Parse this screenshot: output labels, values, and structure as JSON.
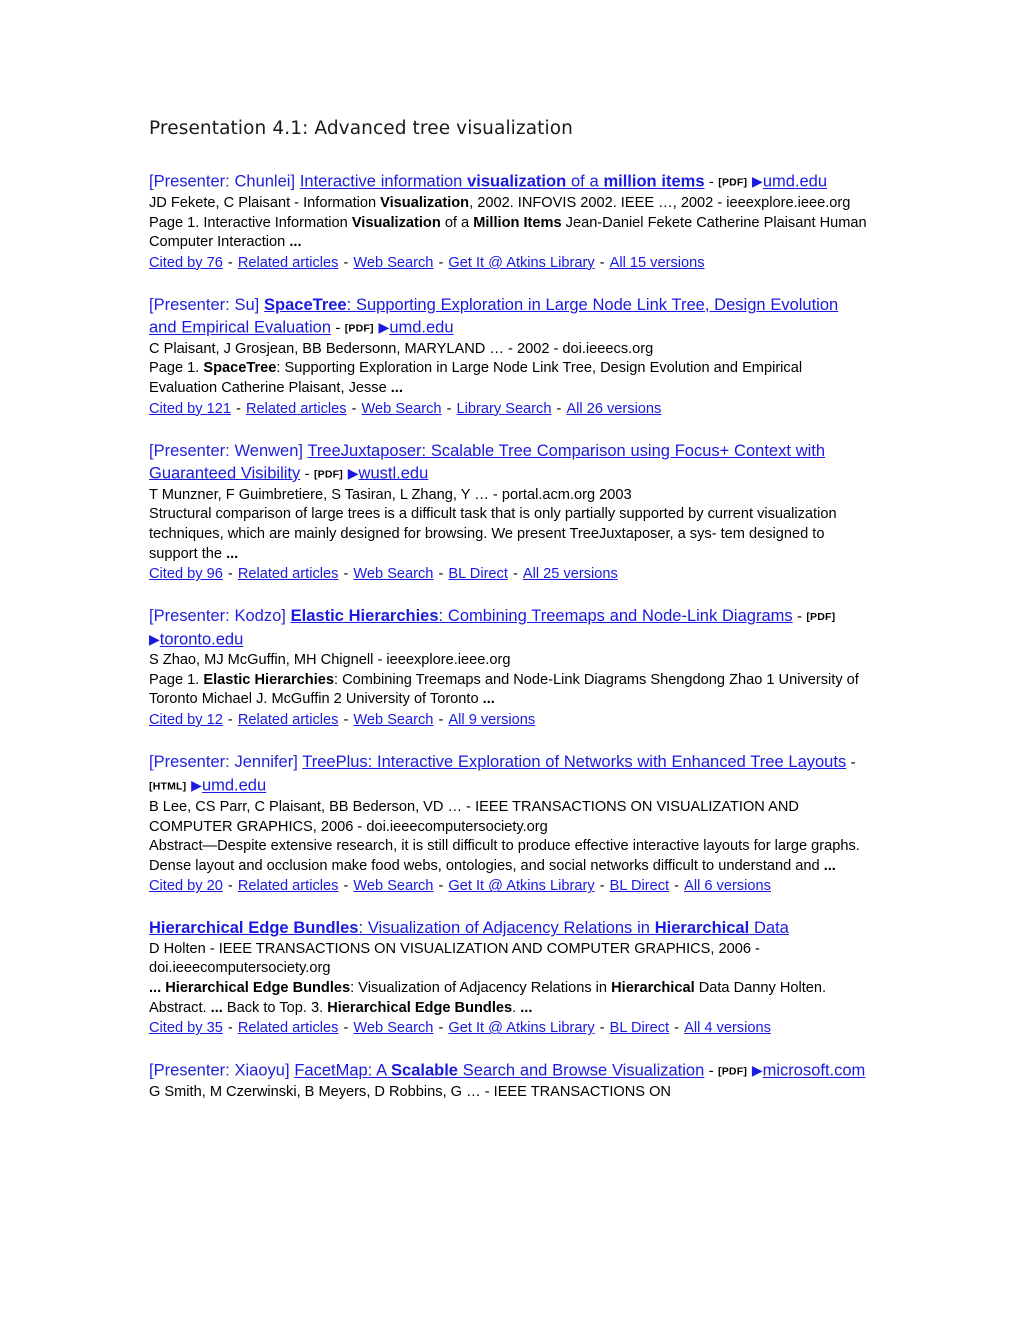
{
  "document": {
    "heading": "Presentation 4.1: Advanced tree visualization"
  },
  "colors": {
    "link": "#1a1ae0",
    "presenter": "#2222dd",
    "text": "#000000",
    "heading": "#1a1a1a",
    "background": "#ffffff"
  },
  "icons": {
    "play_triangle": "▶"
  },
  "separators": {
    "dash": "-",
    "footer_dash": "-"
  },
  "results": [
    {
      "presenter": "[Presenter: Chunlei]",
      "title_parts": [
        {
          "text": "Interactive information ",
          "bold": false
        },
        {
          "text": "visualization",
          "bold": true
        },
        {
          "text": " of a ",
          "bold": false
        },
        {
          "text": "million items",
          "bold": true
        }
      ],
      "file_tag": "[PDF]",
      "domain": "umd.edu",
      "meta": "JD Fekete, C Plaisant - Information Visualization, 2002. INFOVIS 2002. IEEE …, 2002 - ieeexplore.ieee.org",
      "meta_parts": [
        {
          "text": "JD Fekete, C Plaisant - Information ",
          "bold": false
        },
        {
          "text": "Visualization",
          "bold": true
        },
        {
          "text": ", 2002. INFOVIS 2002. IEEE …, 2002 - ieeexplore.ieee.org",
          "bold": false
        }
      ],
      "snippet_parts": [
        {
          "text": "Page 1. Interactive Information ",
          "bold": false
        },
        {
          "text": "Visualization",
          "bold": true
        },
        {
          "text": " of a ",
          "bold": false
        },
        {
          "text": "Million Items",
          "bold": true
        },
        {
          "text": " Jean-Daniel Fekete Catherine Plaisant Human Computer Interaction ",
          "bold": false
        },
        {
          "text": "...",
          "bold": true
        }
      ],
      "footer_links": [
        "Cited by 76",
        "Related articles",
        "Web Search",
        "Get It @ Atkins Library",
        "All 15 versions"
      ]
    },
    {
      "presenter": "[Presenter: Su]",
      "title_parts": [
        {
          "text": "SpaceTree",
          "bold": true
        },
        {
          "text": ": Supporting Exploration in Large Node Link Tree, Design Evolution and Empirical Evaluation",
          "bold": false
        }
      ],
      "file_tag": "[PDF]",
      "domain": "umd.edu",
      "meta_parts": [
        {
          "text": "C Plaisant, J Grosjean, BB Bedersonn, MARYLAND … - 2002 - doi.ieeecs.org",
          "bold": false
        }
      ],
      "snippet_parts": [
        {
          "text": "Page 1. ",
          "bold": false
        },
        {
          "text": "SpaceTree",
          "bold": true
        },
        {
          "text": ": Supporting Exploration in Large Node Link Tree, Design Evolution and Empirical Evaluation Catherine Plaisant, Jesse ",
          "bold": false
        },
        {
          "text": "...",
          "bold": true
        }
      ],
      "footer_links": [
        "Cited by 121",
        "Related articles",
        "Web Search",
        "Library Search",
        "All 26 versions"
      ]
    },
    {
      "presenter": "[Presenter: Wenwen]",
      "title_parts": [
        {
          "text": "TreeJuxtaposer: Scalable Tree Comparison using Focus+ Context with Guaranteed Visibility",
          "bold": false
        }
      ],
      "file_tag": "[PDF]",
      "domain": "wustl.edu",
      "meta_parts": [
        {
          "text": "T Munzner, F Guimbretiere, S Tasiran, L Zhang, Y … - portal.acm.org 2003",
          "bold": false
        }
      ],
      "snippet_parts": [
        {
          "text": "Structural comparison of large trees is a difficult task that is only partially supported by current visualization techniques, which are mainly designed for browsing. We present TreeJuxtaposer, a sys- tem designed to support the ",
          "bold": false
        },
        {
          "text": "...",
          "bold": true
        }
      ],
      "footer_links": [
        "Cited by 96",
        "Related articles",
        "Web Search",
        "BL Direct",
        "All 25 versions"
      ]
    },
    {
      "presenter": "[Presenter: Kodzo]",
      "title_parts": [
        {
          "text": "Elastic Hierarchies",
          "bold": true
        },
        {
          "text": ": Combining Treemaps and Node-Link Diagrams",
          "bold": false
        }
      ],
      "file_tag": "[PDF]",
      "domain": "toronto.edu",
      "meta_parts": [
        {
          "text": "S Zhao, MJ McGuffin, MH Chignell - ieeexplore.ieee.org",
          "bold": false
        }
      ],
      "snippet_parts": [
        {
          "text": "Page 1. ",
          "bold": false
        },
        {
          "text": "Elastic Hierarchies",
          "bold": true
        },
        {
          "text": ": Combining Treemaps and Node-Link Diagrams Shengdong Zhao 1 University of Toronto Michael J. McGuffin 2 University of Toronto ",
          "bold": false
        },
        {
          "text": "...",
          "bold": true
        }
      ],
      "footer_links": [
        "Cited by 12",
        "Related articles",
        "Web Search",
        "All 9 versions"
      ]
    },
    {
      "presenter": "[Presenter: Jennifer]",
      "title_parts": [
        {
          "text": "TreePlus: Interactive Exploration of Networks with Enhanced Tree Layouts",
          "bold": false
        }
      ],
      "file_tag": "[HTML]",
      "domain": "umd.edu",
      "meta_parts": [
        {
          "text": "B Lee, CS Parr, C Plaisant, BB Bederson, VD … - IEEE TRANSACTIONS ON VISUALIZATION AND COMPUTER GRAPHICS, 2006 - doi.ieeecomputersociety.org",
          "bold": false
        }
      ],
      "snippet_parts": [
        {
          "text": "Abstract—Despite extensive research, it is still difficult to produce effective interactive layouts for large graphs. Dense layout and occlusion make food webs, ontologies, and social networks difficult to understand and ",
          "bold": false
        },
        {
          "text": "...",
          "bold": true
        }
      ],
      "footer_links": [
        "Cited by 20",
        "Related articles",
        "Web Search",
        "Get It @ Atkins Library",
        "BL Direct",
        "All 6 versions"
      ]
    },
    {
      "presenter": "",
      "title_parts": [
        {
          "text": "Hierarchical Edge Bundles",
          "bold": true
        },
        {
          "text": ": Visualization of Adjacency Relations in ",
          "bold": false
        },
        {
          "text": "Hierarchical",
          "bold": true
        },
        {
          "text": " Data",
          "bold": false
        }
      ],
      "file_tag": "",
      "domain": "",
      "meta_parts": [
        {
          "text": "D Holten - IEEE TRANSACTIONS ON VISUALIZATION AND COMPUTER GRAPHICS, 2006 - doi.ieeecomputersociety.org",
          "bold": false
        }
      ],
      "snippet_parts": [
        {
          "text": "... ",
          "bold": true
        },
        {
          "text": "Hierarchical Edge Bundles",
          "bold": true
        },
        {
          "text": ": Visualization of Adjacency Relations in ",
          "bold": false
        },
        {
          "text": "Hierarchical",
          "bold": true
        },
        {
          "text": " Data Danny Holten. Abstract. ",
          "bold": false
        },
        {
          "text": "...",
          "bold": true
        },
        {
          "text": " Back to Top. 3. ",
          "bold": false
        },
        {
          "text": "Hierarchical Edge Bundles",
          "bold": true
        },
        {
          "text": ". ",
          "bold": false
        },
        {
          "text": "...",
          "bold": true
        }
      ],
      "footer_links": [
        "Cited by 35",
        "Related articles",
        "Web Search",
        "Get It @ Atkins Library",
        "BL Direct",
        "All 4 versions"
      ]
    },
    {
      "presenter": "[Presenter: Xiaoyu]",
      "title_parts": [
        {
          "text": "FacetMap: A ",
          "bold": false
        },
        {
          "text": "Scalable",
          "bold": true
        },
        {
          "text": " Search and Browse Visualization",
          "bold": false
        }
      ],
      "file_tag": "[PDF]",
      "domain": "microsoft.com",
      "meta_parts": [
        {
          "text": "G Smith, M Czerwinski, B Meyers, D Robbins, G … - IEEE TRANSACTIONS ON",
          "bold": false
        }
      ],
      "snippet_parts": [],
      "footer_links": []
    }
  ]
}
